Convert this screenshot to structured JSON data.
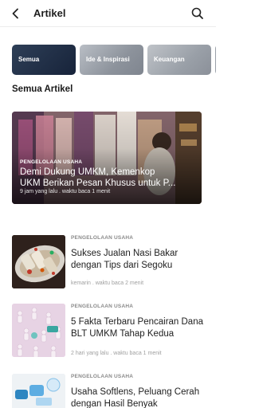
{
  "header": {
    "title": "Artikel",
    "back_icon": "arrow-left-icon",
    "search_icon": "search-icon"
  },
  "tabs": [
    {
      "label": "Semua",
      "selected": true
    },
    {
      "label": "Ide & Inspirasi",
      "selected": false
    },
    {
      "label": "Keuangan",
      "selected": false
    }
  ],
  "section": {
    "title": "Semua Artikel"
  },
  "featured": {
    "category": "PENGELOLAAN USAHA",
    "title_line1": "Demi Dukung UMKM, Kemenkop",
    "title_line2": "UKM Berikan Pesan Khusus untuk P...",
    "meta": "9 jam yang lalu . waktu baca 1 menit"
  },
  "articles": [
    {
      "category": "PENGELOLAAN USAHA",
      "title": "Sukses Jualan Nasi Bakar dengan Tips dari Segoku",
      "meta": "kemarin . waktu baca 2 menit"
    },
    {
      "category": "PENGELOLAAN USAHA",
      "title": "5 Fakta Terbaru Pencairan Dana BLT UMKM Tahap Kedua",
      "meta": "2 hari yang lalu . waktu baca 1 menit"
    },
    {
      "category": "PENGELOLAAN USAHA",
      "title": "Usaha Softlens, Peluang Cerah dengan Hasil Benyak",
      "meta": ""
    }
  ]
}
